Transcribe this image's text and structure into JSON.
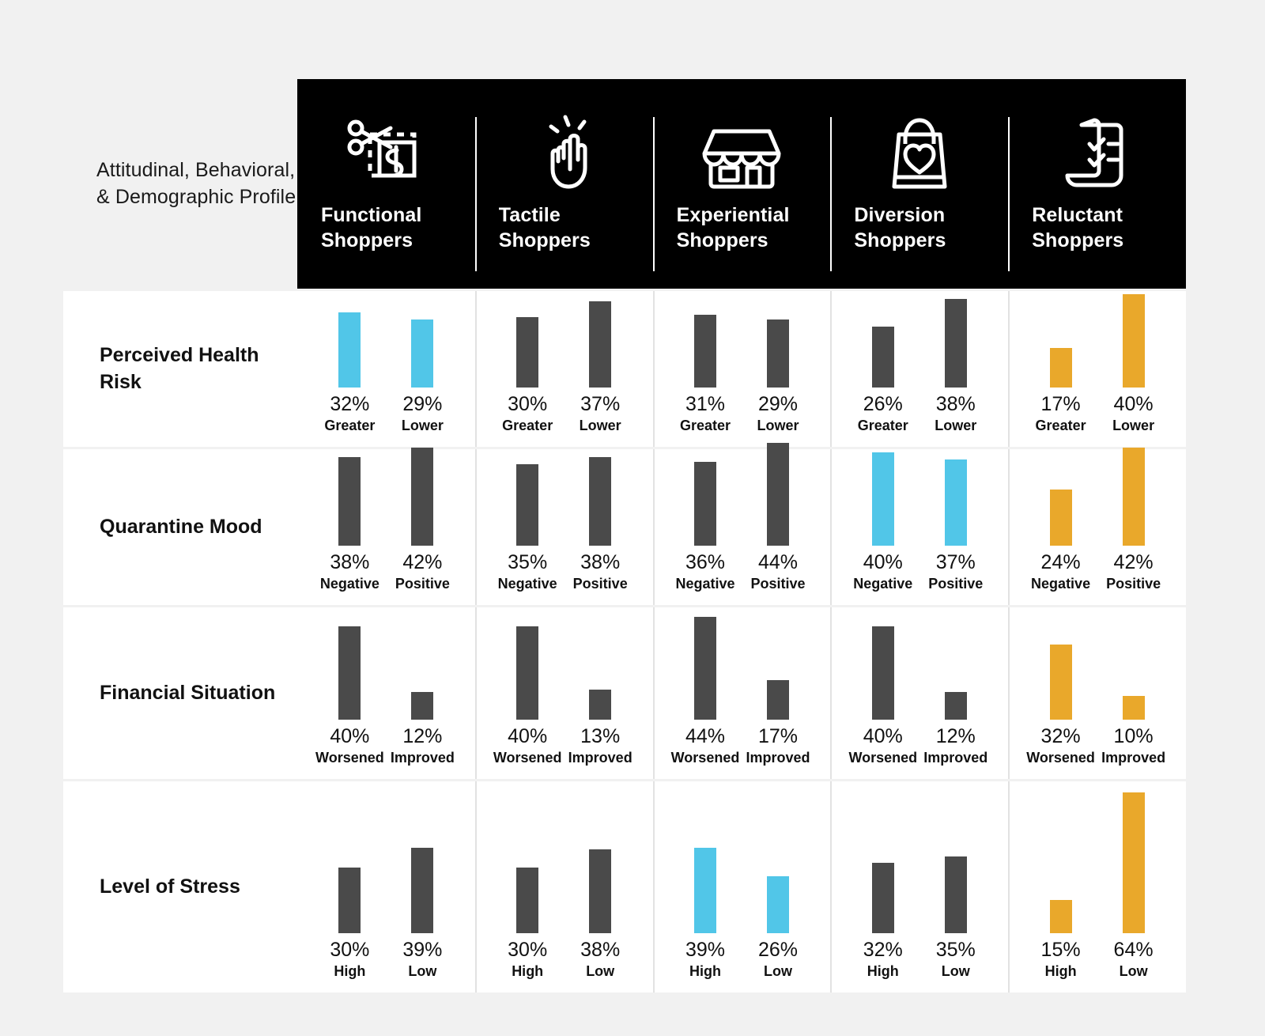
{
  "profile_title": "Attitudinal, Behavioral, & Demographic Profile",
  "colors": {
    "background": "#F1F1F1",
    "header_bg": "#000000",
    "bar_default": "#4A4A4A",
    "bar_cyan": "#51C6E8",
    "bar_gold": "#E9A82B",
    "text": "#111111"
  },
  "columns": [
    {
      "name": "Functional",
      "second": "Shoppers",
      "icon": "coupon-scissors-icon"
    },
    {
      "name": "Tactile",
      "second": "Shoppers",
      "icon": "pointing-finger-icon"
    },
    {
      "name": "Experiential",
      "second": "Shoppers",
      "icon": "storefront-icon"
    },
    {
      "name": "Diversion",
      "second": "Shoppers",
      "icon": "shopping-bag-heart-icon"
    },
    {
      "name": "Reluctant",
      "second": "Shoppers",
      "icon": "checklist-receipt-icon"
    }
  ],
  "chart_data": {
    "type": "bar",
    "title": "Attitudinal, Behavioral, & Demographic Profile",
    "xlabel": "",
    "ylabel": "",
    "ylim": [
      0,
      64
    ],
    "grid": false,
    "legend": "none",
    "categories": [
      "Functional Shoppers",
      "Tactile Shoppers",
      "Experiential Shoppers",
      "Diversion Shoppers",
      "Reluctant Shoppers"
    ],
    "rows": [
      {
        "label": "Perceived Health Risk",
        "cells": [
          {
            "column": "Functional Shoppers",
            "highlight": "cyan",
            "bars": [
              {
                "value": 32,
                "pct": "32%",
                "sub": "Greater"
              },
              {
                "value": 29,
                "pct": "29%",
                "sub": "Lower"
              }
            ]
          },
          {
            "column": "Tactile Shoppers",
            "highlight": "none",
            "bars": [
              {
                "value": 30,
                "pct": "30%",
                "sub": "Greater"
              },
              {
                "value": 37,
                "pct": "37%",
                "sub": "Lower"
              }
            ]
          },
          {
            "column": "Experiential Shoppers",
            "highlight": "none",
            "bars": [
              {
                "value": 31,
                "pct": "31%",
                "sub": "Greater"
              },
              {
                "value": 29,
                "pct": "29%",
                "sub": "Lower"
              }
            ]
          },
          {
            "column": "Diversion Shoppers",
            "highlight": "none",
            "bars": [
              {
                "value": 26,
                "pct": "26%",
                "sub": "Greater"
              },
              {
                "value": 38,
                "pct": "38%",
                "sub": "Lower"
              }
            ]
          },
          {
            "column": "Reluctant Shoppers",
            "highlight": "gold",
            "bars": [
              {
                "value": 17,
                "pct": "17%",
                "sub": "Greater"
              },
              {
                "value": 40,
                "pct": "40%",
                "sub": "Lower"
              }
            ]
          }
        ]
      },
      {
        "label": "Quarantine Mood",
        "cells": [
          {
            "column": "Functional Shoppers",
            "highlight": "none",
            "bars": [
              {
                "value": 38,
                "pct": "38%",
                "sub": "Negative"
              },
              {
                "value": 42,
                "pct": "42%",
                "sub": "Positive"
              }
            ]
          },
          {
            "column": "Tactile Shoppers",
            "highlight": "none",
            "bars": [
              {
                "value": 35,
                "pct": "35%",
                "sub": "Negative"
              },
              {
                "value": 38,
                "pct": "38%",
                "sub": "Positive"
              }
            ]
          },
          {
            "column": "Experiential Shoppers",
            "highlight": "none",
            "bars": [
              {
                "value": 36,
                "pct": "36%",
                "sub": "Negative"
              },
              {
                "value": 44,
                "pct": "44%",
                "sub": "Positive"
              }
            ]
          },
          {
            "column": "Diversion Shoppers",
            "highlight": "cyan",
            "bars": [
              {
                "value": 40,
                "pct": "40%",
                "sub": "Negative"
              },
              {
                "value": 37,
                "pct": "37%",
                "sub": "Positive"
              }
            ]
          },
          {
            "column": "Reluctant Shoppers",
            "highlight": "gold",
            "bars": [
              {
                "value": 24,
                "pct": "24%",
                "sub": "Negative"
              },
              {
                "value": 42,
                "pct": "42%",
                "sub": "Positive"
              }
            ]
          }
        ]
      },
      {
        "label": "Financial Situation",
        "cells": [
          {
            "column": "Functional Shoppers",
            "highlight": "none",
            "bars": [
              {
                "value": 40,
                "pct": "40%",
                "sub": "Worsened"
              },
              {
                "value": 12,
                "pct": "12%",
                "sub": "Improved"
              }
            ]
          },
          {
            "column": "Tactile Shoppers",
            "highlight": "none",
            "bars": [
              {
                "value": 40,
                "pct": "40%",
                "sub": "Worsened"
              },
              {
                "value": 13,
                "pct": "13%",
                "sub": "Improved"
              }
            ]
          },
          {
            "column": "Experiential Shoppers",
            "highlight": "none",
            "bars": [
              {
                "value": 44,
                "pct": "44%",
                "sub": "Worsened"
              },
              {
                "value": 17,
                "pct": "17%",
                "sub": "Improved"
              }
            ]
          },
          {
            "column": "Diversion Shoppers",
            "highlight": "none",
            "bars": [
              {
                "value": 40,
                "pct": "40%",
                "sub": "Worsened"
              },
              {
                "value": 12,
                "pct": "12%",
                "sub": "Improved"
              }
            ]
          },
          {
            "column": "Reluctant Shoppers",
            "highlight": "gold",
            "bars": [
              {
                "value": 32,
                "pct": "32%",
                "sub": "Worsened"
              },
              {
                "value": 10,
                "pct": "10%",
                "sub": "Improved"
              }
            ]
          }
        ]
      },
      {
        "label": "Level of Stress",
        "cells": [
          {
            "column": "Functional Shoppers",
            "highlight": "none",
            "bars": [
              {
                "value": 30,
                "pct": "30%",
                "sub": "High"
              },
              {
                "value": 39,
                "pct": "39%",
                "sub": "Low"
              }
            ]
          },
          {
            "column": "Tactile Shoppers",
            "highlight": "none",
            "bars": [
              {
                "value": 30,
                "pct": "30%",
                "sub": "High"
              },
              {
                "value": 38,
                "pct": "38%",
                "sub": "Low"
              }
            ]
          },
          {
            "column": "Experiential Shoppers",
            "highlight": "cyan",
            "bars": [
              {
                "value": 39,
                "pct": "39%",
                "sub": "High"
              },
              {
                "value": 26,
                "pct": "26%",
                "sub": "Low"
              }
            ]
          },
          {
            "column": "Diversion Shoppers",
            "highlight": "none",
            "bars": [
              {
                "value": 32,
                "pct": "32%",
                "sub": "High"
              },
              {
                "value": 35,
                "pct": "35%",
                "sub": "Low"
              }
            ]
          },
          {
            "column": "Reluctant Shoppers",
            "highlight": "gold",
            "bars": [
              {
                "value": 15,
                "pct": "15%",
                "sub": "High"
              },
              {
                "value": 64,
                "pct": "64%",
                "sub": "Low"
              }
            ]
          }
        ]
      }
    ]
  }
}
